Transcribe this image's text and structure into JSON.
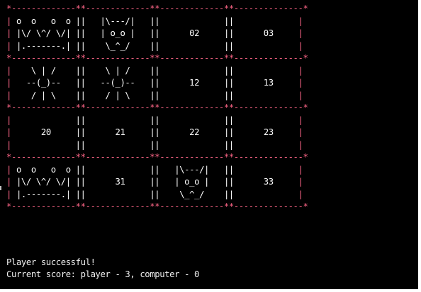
{
  "board": {
    "rows": [
      [
        {
          "type": "art",
          "lines": [
            "| o  o   o  o ||",
            "| |\\/ \\^/ \\/| ||",
            "| |.-------.| ||"
          ]
        },
        {
          "type": "art",
          "lines": [
            "   |\\---/|   ||",
            "   | o_o |   ||",
            "    \\_^_/    ||"
          ]
        },
        {
          "type": "num",
          "label": "02"
        },
        {
          "type": "num",
          "label": "03"
        }
      ],
      [
        {
          "type": "art",
          "lines": [
            "|    \\ | /    ||",
            "|   --(_)--   ||",
            "|    / | \\    ||"
          ]
        },
        {
          "type": "art",
          "lines": [
            "    \\ | /    ||",
            "   --(_)--   ||",
            "    / | \\    ||"
          ]
        },
        {
          "type": "num",
          "label": "12"
        },
        {
          "type": "num",
          "label": "13"
        }
      ],
      [
        {
          "type": "num",
          "label": "20"
        },
        {
          "type": "num",
          "label": "21"
        },
        {
          "type": "num",
          "label": "22"
        },
        {
          "type": "num",
          "label": "23"
        }
      ],
      [
        {
          "type": "art",
          "lines": [
            "| o  o   o  o ||",
            "| |\\/ \\^/ \\/| ||",
            "| |.-------.| ||"
          ]
        },
        {
          "type": "num",
          "label": "31"
        },
        {
          "type": "art",
          "lines": [
            "   |\\---/|   ||",
            "   | o_o |   ||",
            "    \\_^_/    ||"
          ]
        },
        {
          "type": "num",
          "label": "33"
        }
      ]
    ]
  },
  "messages": {
    "status": "Player successful!",
    "score": "Current score: player - 3, computer - 0"
  }
}
